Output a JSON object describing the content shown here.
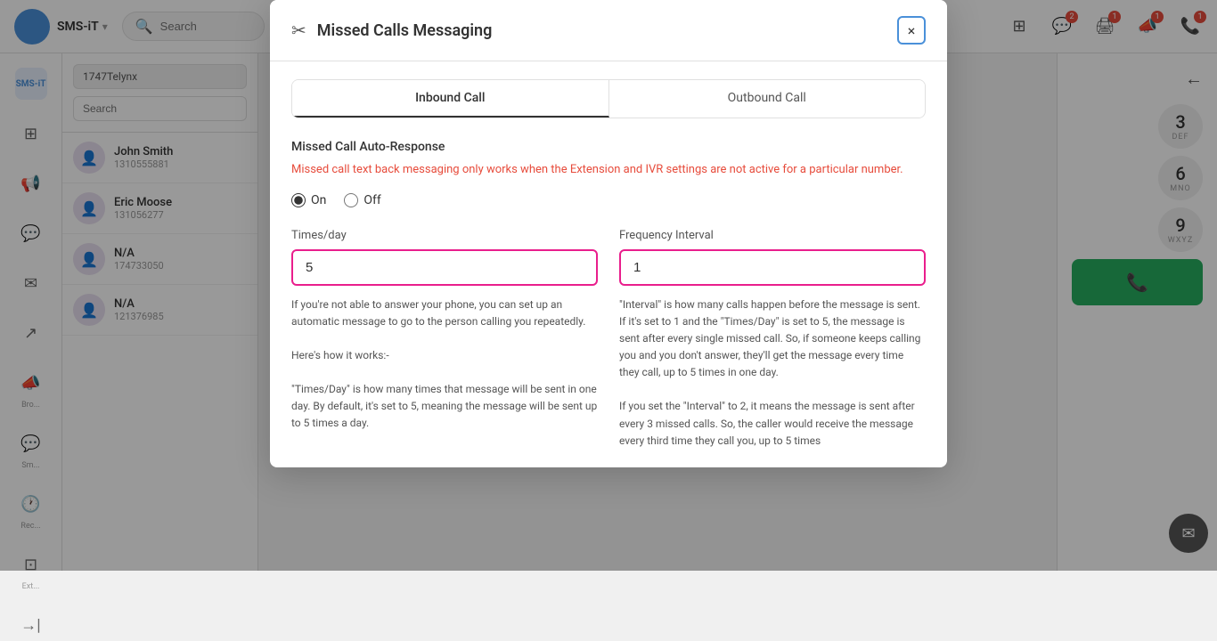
{
  "app": {
    "brand": "SMS-iT",
    "search_placeholder": "Search"
  },
  "top_nav_icons": [
    {
      "name": "grid-icon",
      "symbol": "⊞"
    },
    {
      "name": "chat-icon",
      "symbol": "💬",
      "badge": "2"
    },
    {
      "name": "print-icon",
      "symbol": "🖨",
      "badge": "1"
    },
    {
      "name": "megaphone-icon",
      "symbol": "📣",
      "badge": "1"
    },
    {
      "name": "phone-icon",
      "symbol": "📞",
      "badge": "1"
    }
  ],
  "sidebar": {
    "items": [
      {
        "name": "dashboard-icon",
        "symbol": "⊞",
        "label": ""
      },
      {
        "name": "megaphone-icon",
        "symbol": "📢",
        "label": ""
      },
      {
        "name": "chat-bubble-icon",
        "symbol": "💬",
        "label": ""
      },
      {
        "name": "email-icon",
        "symbol": "✉",
        "label": ""
      },
      {
        "name": "share-icon",
        "symbol": "↗",
        "label": ""
      },
      {
        "name": "broadcast-icon",
        "symbol": "📣",
        "label": "Bro..."
      },
      {
        "name": "sms-icon",
        "symbol": "💬",
        "label": "Sm..."
      },
      {
        "name": "recent-icon",
        "symbol": "🕐",
        "label": "Rec..."
      },
      {
        "name": "extension-icon",
        "symbol": "⊡",
        "label": "Ext..."
      },
      {
        "name": "logout-icon",
        "symbol": "→|",
        "label": ""
      }
    ]
  },
  "contact_panel": {
    "phone_number": "1747Telynx",
    "search_placeholder": "Search",
    "contacts": [
      {
        "name": "John Smith",
        "phone": "1310555881",
        "initials": "👤"
      },
      {
        "name": "Eric Moose",
        "phone": "131056277",
        "initials": "👤"
      },
      {
        "name": "N/A",
        "phone": "174733050",
        "initials": "👤"
      },
      {
        "name": "N/A",
        "phone": "121376985",
        "initials": "👤"
      }
    ]
  },
  "keypad": {
    "back_arrow": "←",
    "keys": [
      {
        "num": "3",
        "sub": "DEF"
      },
      {
        "num": "6",
        "sub": "MNO"
      },
      {
        "num": "9",
        "sub": "WXYZ"
      }
    ],
    "call_button_color": "#27ae60"
  },
  "modal": {
    "title": "Missed Calls Messaging",
    "icon": "✂",
    "close_label": "×",
    "tabs": [
      {
        "label": "Inbound Call",
        "active": true
      },
      {
        "label": "Outbound Call",
        "active": false
      }
    ],
    "section_title": "Missed Call Auto-Response",
    "warning": "Missed call text back messaging only works when the Extension and IVR settings are not active for a particular number.",
    "radio_on": "On",
    "radio_off": "Off",
    "times_day_label": "Times/day",
    "times_day_value": "5",
    "frequency_label": "Frequency Interval",
    "frequency_value": "1",
    "left_desc_1": "If you're not able to answer your phone, you can set up an automatic message to go to the person calling you repeatedly.",
    "left_desc_2": "Here's how it works:-",
    "left_desc_3": "\"Times/Day\" is how many times that message will be sent in one day. By default, it's set to 5, meaning the message will be sent up to 5 times a day.",
    "right_desc_1": "\"Interval\" is how many calls happen before the message is sent. If it's set to 1 and the \"Times/Day\" is set to 5, the message is sent after every single missed call. So, if someone keeps calling you and you don't answer, they'll get the message every time they call, up to 5 times in one day.",
    "right_desc_2": "If you set the \"Interval\" to 2, it means the message is sent after every 3 missed calls. So, the caller would receive the message every third time they call you, up to 5 times"
  }
}
